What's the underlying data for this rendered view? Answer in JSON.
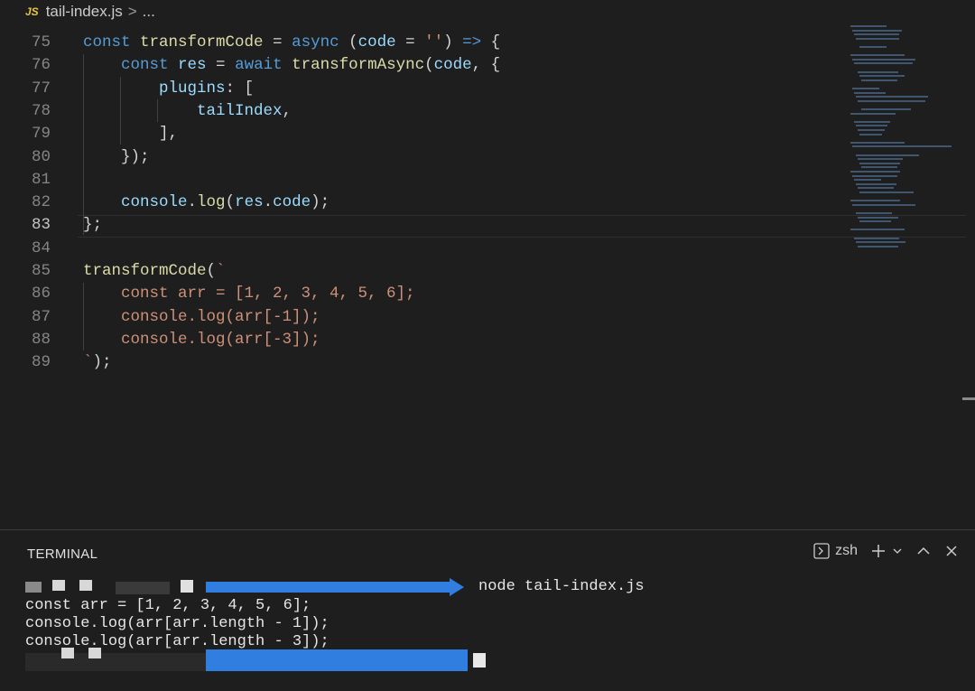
{
  "breadcrumb": {
    "file_badge": "JS",
    "file_name": "tail-index.js",
    "separator": ">",
    "more": "..."
  },
  "editor": {
    "active_line": "83",
    "lines": [
      {
        "num": "75",
        "tokens": [
          [
            "kw",
            "const "
          ],
          [
            "fn",
            "transformCode"
          ],
          [
            "pl",
            " = "
          ],
          [
            "kw",
            "async"
          ],
          [
            "pl",
            " ("
          ],
          [
            "vr",
            "code"
          ],
          [
            "pl",
            " = "
          ],
          [
            "st",
            "''"
          ],
          [
            "pl",
            ") "
          ],
          [
            "kw",
            "=>"
          ],
          [
            "pl",
            " {"
          ]
        ]
      },
      {
        "num": "76",
        "tokens": [
          [
            "pl",
            "    "
          ],
          [
            "kw",
            "const "
          ],
          [
            "vr",
            "res"
          ],
          [
            "pl",
            " = "
          ],
          [
            "kw",
            "await "
          ],
          [
            "fn",
            "transformAsync"
          ],
          [
            "pl",
            "("
          ],
          [
            "vr",
            "code"
          ],
          [
            "pl",
            ", {"
          ]
        ]
      },
      {
        "num": "77",
        "tokens": [
          [
            "pl",
            "        "
          ],
          [
            "vr",
            "plugins"
          ],
          [
            "pl",
            ": ["
          ]
        ]
      },
      {
        "num": "78",
        "tokens": [
          [
            "pl",
            "            "
          ],
          [
            "vr",
            "tailIndex"
          ],
          [
            "pl",
            ","
          ]
        ]
      },
      {
        "num": "79",
        "tokens": [
          [
            "pl",
            "        ],"
          ]
        ]
      },
      {
        "num": "80",
        "tokens": [
          [
            "pl",
            "    });"
          ]
        ]
      },
      {
        "num": "81",
        "tokens": []
      },
      {
        "num": "82",
        "tokens": [
          [
            "pl",
            "    "
          ],
          [
            "vr",
            "console"
          ],
          [
            "pl",
            "."
          ],
          [
            "fn",
            "log"
          ],
          [
            "pl",
            "("
          ],
          [
            "vr",
            "res"
          ],
          [
            "pl",
            "."
          ],
          [
            "vr",
            "code"
          ],
          [
            "pl",
            ");"
          ]
        ]
      },
      {
        "num": "83",
        "tokens": [
          [
            "pl",
            "};"
          ]
        ]
      },
      {
        "num": "84",
        "tokens": []
      },
      {
        "num": "85",
        "tokens": [
          [
            "fn",
            "transformCode"
          ],
          [
            "pl",
            "("
          ],
          [
            "st",
            "`"
          ]
        ]
      },
      {
        "num": "86",
        "tokens": [
          [
            "st",
            "    const arr = [1, 2, 3, 4, 5, 6];"
          ]
        ]
      },
      {
        "num": "87",
        "tokens": [
          [
            "st",
            "    console.log(arr[-1]);"
          ]
        ]
      },
      {
        "num": "88",
        "tokens": [
          [
            "st",
            "    console.log(arr[-3]);"
          ]
        ]
      },
      {
        "num": "89",
        "tokens": [
          [
            "st",
            "`"
          ],
          [
            "pl",
            ");"
          ]
        ]
      }
    ]
  },
  "terminal": {
    "title": "TERMINAL",
    "shell": "zsh",
    "command": "node tail-index.js",
    "output": [
      "const arr = [1, 2, 3, 4, 5, 6];",
      "console.log(arr[arr.length - 1]);",
      "console.log(arr[arr.length - 3]);"
    ]
  },
  "colors": {
    "keyword": "#569cd6",
    "function": "#dcdcaa",
    "variable": "#9cdcfe",
    "string": "#ce9178",
    "redaction_blue": "#2f7ee0"
  },
  "icons": [
    "terminal-icon",
    "plus-icon",
    "chevron-down-icon",
    "chevron-up-icon",
    "close-icon"
  ]
}
